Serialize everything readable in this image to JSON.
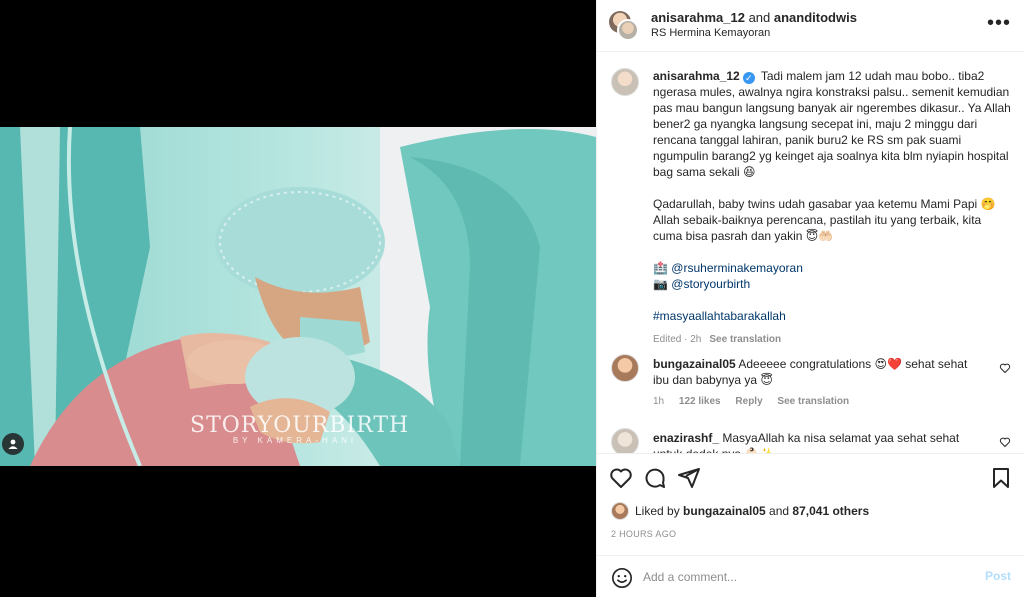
{
  "header": {
    "user1": "anisarahma_12",
    "and_text": " and ",
    "user2": "ananditodwis",
    "location": "RS Hermina Kemayoran",
    "more_glyph": "•••"
  },
  "media": {
    "watermark_title": "STORYOURBIRTH",
    "watermark_sub": "BY KAMERA-HANI"
  },
  "caption": {
    "username": "anisarahma_12",
    "verified_glyph": "✓",
    "text1": "Tadi malem jam 12 udah mau bobo.. tiba2 ngerasa mules, awalnya ngira konstraksi palsu.. semenit kemudian pas mau bangun langsung banyak air ngerembes dikasur.. Ya Allah bener2 ga nyangka langsung secepat ini, maju 2 minggu dari rencana tanggal lahiran, panik buru2 ke RS sm pak suami ngumpulin barang2 yg keinget aja soalnya kita blm nyiapin hospital bag sama sekali 😆",
    "text2": "Qadarullah, baby twins udah gasabar yaa ketemu Mami Papi 🤭 Allah sebaik-baiknya perencana, pastilah itu yang terbaik, kita cuma bisa pasrah dan yakin 😇🤲🏻",
    "mention1_emoji": "🏥",
    "mention1": "@rsuherminakemayoran",
    "mention2_emoji": "📷",
    "mention2": "@storyourbirth",
    "hashtag": "#masyaallahtabarakallah",
    "edited": "Edited · 2h",
    "see_translation": "See translation"
  },
  "comments": [
    {
      "username": "bungazainal05",
      "text": "Adeeeee congratulations 😍❤️ sehat sehat ibu dan babynya ya 😇",
      "time": "1h",
      "likes": "122 likes",
      "reply": "Reply",
      "see_translation": "See translation"
    },
    {
      "username": "enazirashf_",
      "text": "MasyaAllah ka nisa selamat yaa sehat sehat untuk dedek nya 👶🏻✨"
    }
  ],
  "likes": {
    "prefix": "Liked by ",
    "user": "bungazainal05",
    "and": " and ",
    "others": "87,041 others"
  },
  "timestamp": "2 HOURS AGO",
  "add_comment": {
    "placeholder": "Add a comment...",
    "post_label": "Post"
  },
  "colors": {
    "verified": "#3897f0",
    "link": "#00376b",
    "post_disabled": "#b2dffc",
    "heart_red": "#ed4956"
  }
}
